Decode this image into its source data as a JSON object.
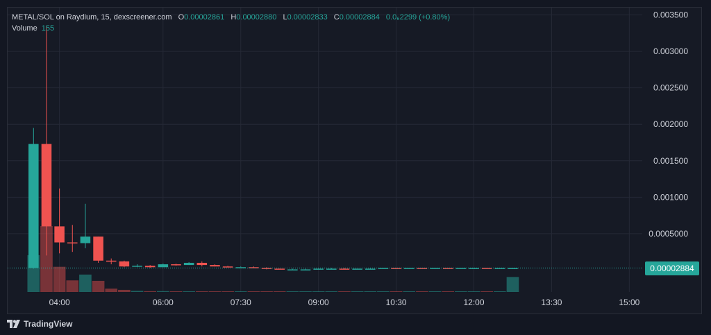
{
  "header": {
    "symbol": "METAL/SOL on Raydium, 15, dexscreener.com",
    "o_label": "O",
    "o_value": "0.00002861",
    "h_label": "H",
    "h_value": "0.00002880",
    "l_label": "L",
    "l_value": "0.00002833",
    "c_label": "C",
    "c_value": "0.00002884",
    "change": "0.0₆2299 (+0.80%)",
    "volume_label": "Volume",
    "volume_value": "155"
  },
  "price_tag": "0.00002884",
  "branding": {
    "name": "TradingView"
  },
  "colors": {
    "up": "#26a69a",
    "down": "#ef5350",
    "grid": "#252936",
    "text": "#d1d4dc",
    "background": "#161a25"
  },
  "chart_data": {
    "type": "candlestick",
    "timeframe": "15",
    "ylim": [
      -0.0003,
      0.0036
    ],
    "y_ticks": [
      "0.003500",
      "0.003000",
      "0.002500",
      "0.002000",
      "0.001500",
      "0.001000",
      "0.0005000"
    ],
    "y_tick_values": [
      0.0035,
      0.003,
      0.0025,
      0.002,
      0.0015,
      0.001,
      0.0005
    ],
    "x_ticks": [
      "04:00",
      "06:00",
      "07:30",
      "09:00",
      "10:30",
      "12:00",
      "13:30",
      "15:00"
    ],
    "x_tick_values": [
      "04:00",
      "06:00",
      "07:30",
      "09:00",
      "10:30",
      "12:00",
      "13:30",
      "15:00"
    ],
    "x_range": [
      "03:00",
      "15:15"
    ],
    "last_price": 2.884e-05,
    "candles": [
      {
        "t": "03:30",
        "o": 3e-05,
        "h": 0.00195,
        "l": 2e-05,
        "c": 0.00173,
        "v": 380
      },
      {
        "t": "03:45",
        "o": 0.00173,
        "h": 0.00335,
        "l": 0.0002,
        "c": 0.0006,
        "v": 680
      },
      {
        "t": "04:00",
        "o": 0.0006,
        "h": 0.00112,
        "l": 0.00023,
        "c": 0.00038,
        "v": 260
      },
      {
        "t": "04:15",
        "o": 0.00038,
        "h": 0.00062,
        "l": 0.00025,
        "c": 0.00037,
        "v": 120
      },
      {
        "t": "04:30",
        "o": 0.00037,
        "h": 0.00091,
        "l": 0.0003,
        "c": 0.00046,
        "v": 180
      },
      {
        "t": "04:45",
        "o": 0.00046,
        "h": 0.00046,
        "l": 0.0001,
        "c": 0.00013,
        "v": 115
      },
      {
        "t": "05:00",
        "o": 0.00013,
        "h": 0.00016,
        "l": 8e-05,
        "c": 0.00012,
        "v": 35
      },
      {
        "t": "05:15",
        "o": 0.00012,
        "h": 0.00013,
        "l": 4e-05,
        "c": 5e-05,
        "v": 22
      },
      {
        "t": "05:30",
        "o": 5e-05,
        "h": 8e-05,
        "l": 4e-05,
        "c": 6e-05,
        "v": 12
      },
      {
        "t": "05:45",
        "o": 6e-05,
        "h": 7e-05,
        "l": 3e-05,
        "c": 4e-05,
        "v": 8
      },
      {
        "t": "06:00",
        "o": 4e-05,
        "h": 9e-05,
        "l": 4e-05,
        "c": 8e-05,
        "v": 9
      },
      {
        "t": "06:15",
        "o": 8e-05,
        "h": 9e-05,
        "l": 6e-05,
        "c": 7e-05,
        "v": 6
      },
      {
        "t": "06:30",
        "o": 7e-05,
        "h": 0.00011,
        "l": 7e-05,
        "c": 0.0001,
        "v": 7
      },
      {
        "t": "06:45",
        "o": 0.0001,
        "h": 0.00012,
        "l": 5e-05,
        "c": 7e-05,
        "v": 6
      },
      {
        "t": "07:00",
        "o": 7e-05,
        "h": 8e-05,
        "l": 5e-05,
        "c": 5e-05,
        "v": 5
      },
      {
        "t": "07:15",
        "o": 5e-05,
        "h": 6e-05,
        "l": 4e-05,
        "c": 4e-05,
        "v": 4
      },
      {
        "t": "07:30",
        "o": 4e-05,
        "h": 5e-05,
        "l": 4e-05,
        "c": 4e-05,
        "v": 3
      },
      {
        "t": "07:45",
        "o": 4e-05,
        "h": 5e-05,
        "l": 3e-05,
        "c": 3e-05,
        "v": 3
      },
      {
        "t": "08:00",
        "o": 3e-05,
        "h": 4e-05,
        "l": 1e-05,
        "c": 2e-05,
        "v": 5
      },
      {
        "t": "08:15",
        "o": 2e-05,
        "h": 2e-05,
        "l": 1e-05,
        "c": 1e-05,
        "v": 3
      },
      {
        "t": "08:30",
        "o": 1e-05,
        "h": 2e-05,
        "l": 1e-05,
        "c": 1e-05,
        "v": 2
      },
      {
        "t": "08:45",
        "o": 1e-05,
        "h": 2e-05,
        "l": 1e-05,
        "c": 1e-05,
        "v": 2
      },
      {
        "t": "09:00",
        "o": 1e-05,
        "h": 2e-05,
        "l": 1e-05,
        "c": 2e-05,
        "v": 2
      },
      {
        "t": "09:15",
        "o": 2e-05,
        "h": 3e-05,
        "l": 1e-05,
        "c": 2e-05,
        "v": 2
      },
      {
        "t": "09:30",
        "o": 2e-05,
        "h": 3e-05,
        "l": 1e-05,
        "c": 1e-05,
        "v": 2
      },
      {
        "t": "09:45",
        "o": 1e-05,
        "h": 2e-05,
        "l": 1e-05,
        "c": 2e-05,
        "v": 2
      },
      {
        "t": "10:00",
        "o": 2e-05,
        "h": 3e-05,
        "l": 2e-05,
        "c": 2e-05,
        "v": 2
      },
      {
        "t": "10:15",
        "o": 2e-05,
        "h": 3e-05,
        "l": 2e-05,
        "c": 3e-05,
        "v": 2
      },
      {
        "t": "10:30",
        "o": 3e-05,
        "h": 3e-05,
        "l": 2e-05,
        "c": 2e-05,
        "v": 2
      },
      {
        "t": "10:45",
        "o": 2e-05,
        "h": 3e-05,
        "l": 2e-05,
        "c": 3e-05,
        "v": 2
      },
      {
        "t": "11:00",
        "o": 3e-05,
        "h": 3e-05,
        "l": 2e-05,
        "c": 2e-05,
        "v": 2
      },
      {
        "t": "11:15",
        "o": 2e-05,
        "h": 3e-05,
        "l": 2e-05,
        "c": 3e-05,
        "v": 2
      },
      {
        "t": "11:30",
        "o": 3e-05,
        "h": 3e-05,
        "l": 2e-05,
        "c": 2e-05,
        "v": 2
      },
      {
        "t": "11:45",
        "o": 2e-05,
        "h": 3e-05,
        "l": 2e-05,
        "c": 3e-05,
        "v": 2
      },
      {
        "t": "12:00",
        "o": 3e-05,
        "h": 3e-05,
        "l": 2e-05,
        "c": 3e-05,
        "v": 2
      },
      {
        "t": "12:15",
        "o": 3e-05,
        "h": 3e-05,
        "l": 2e-05,
        "c": 2e-05,
        "v": 2
      },
      {
        "t": "12:30",
        "o": 2e-05,
        "h": 3e-05,
        "l": 2e-05,
        "c": 3e-05,
        "v": 2
      },
      {
        "t": "12:45",
        "o": 2.861e-05,
        "h": 2.88e-05,
        "l": 2.833e-05,
        "c": 2.884e-05,
        "v": 155
      }
    ]
  }
}
